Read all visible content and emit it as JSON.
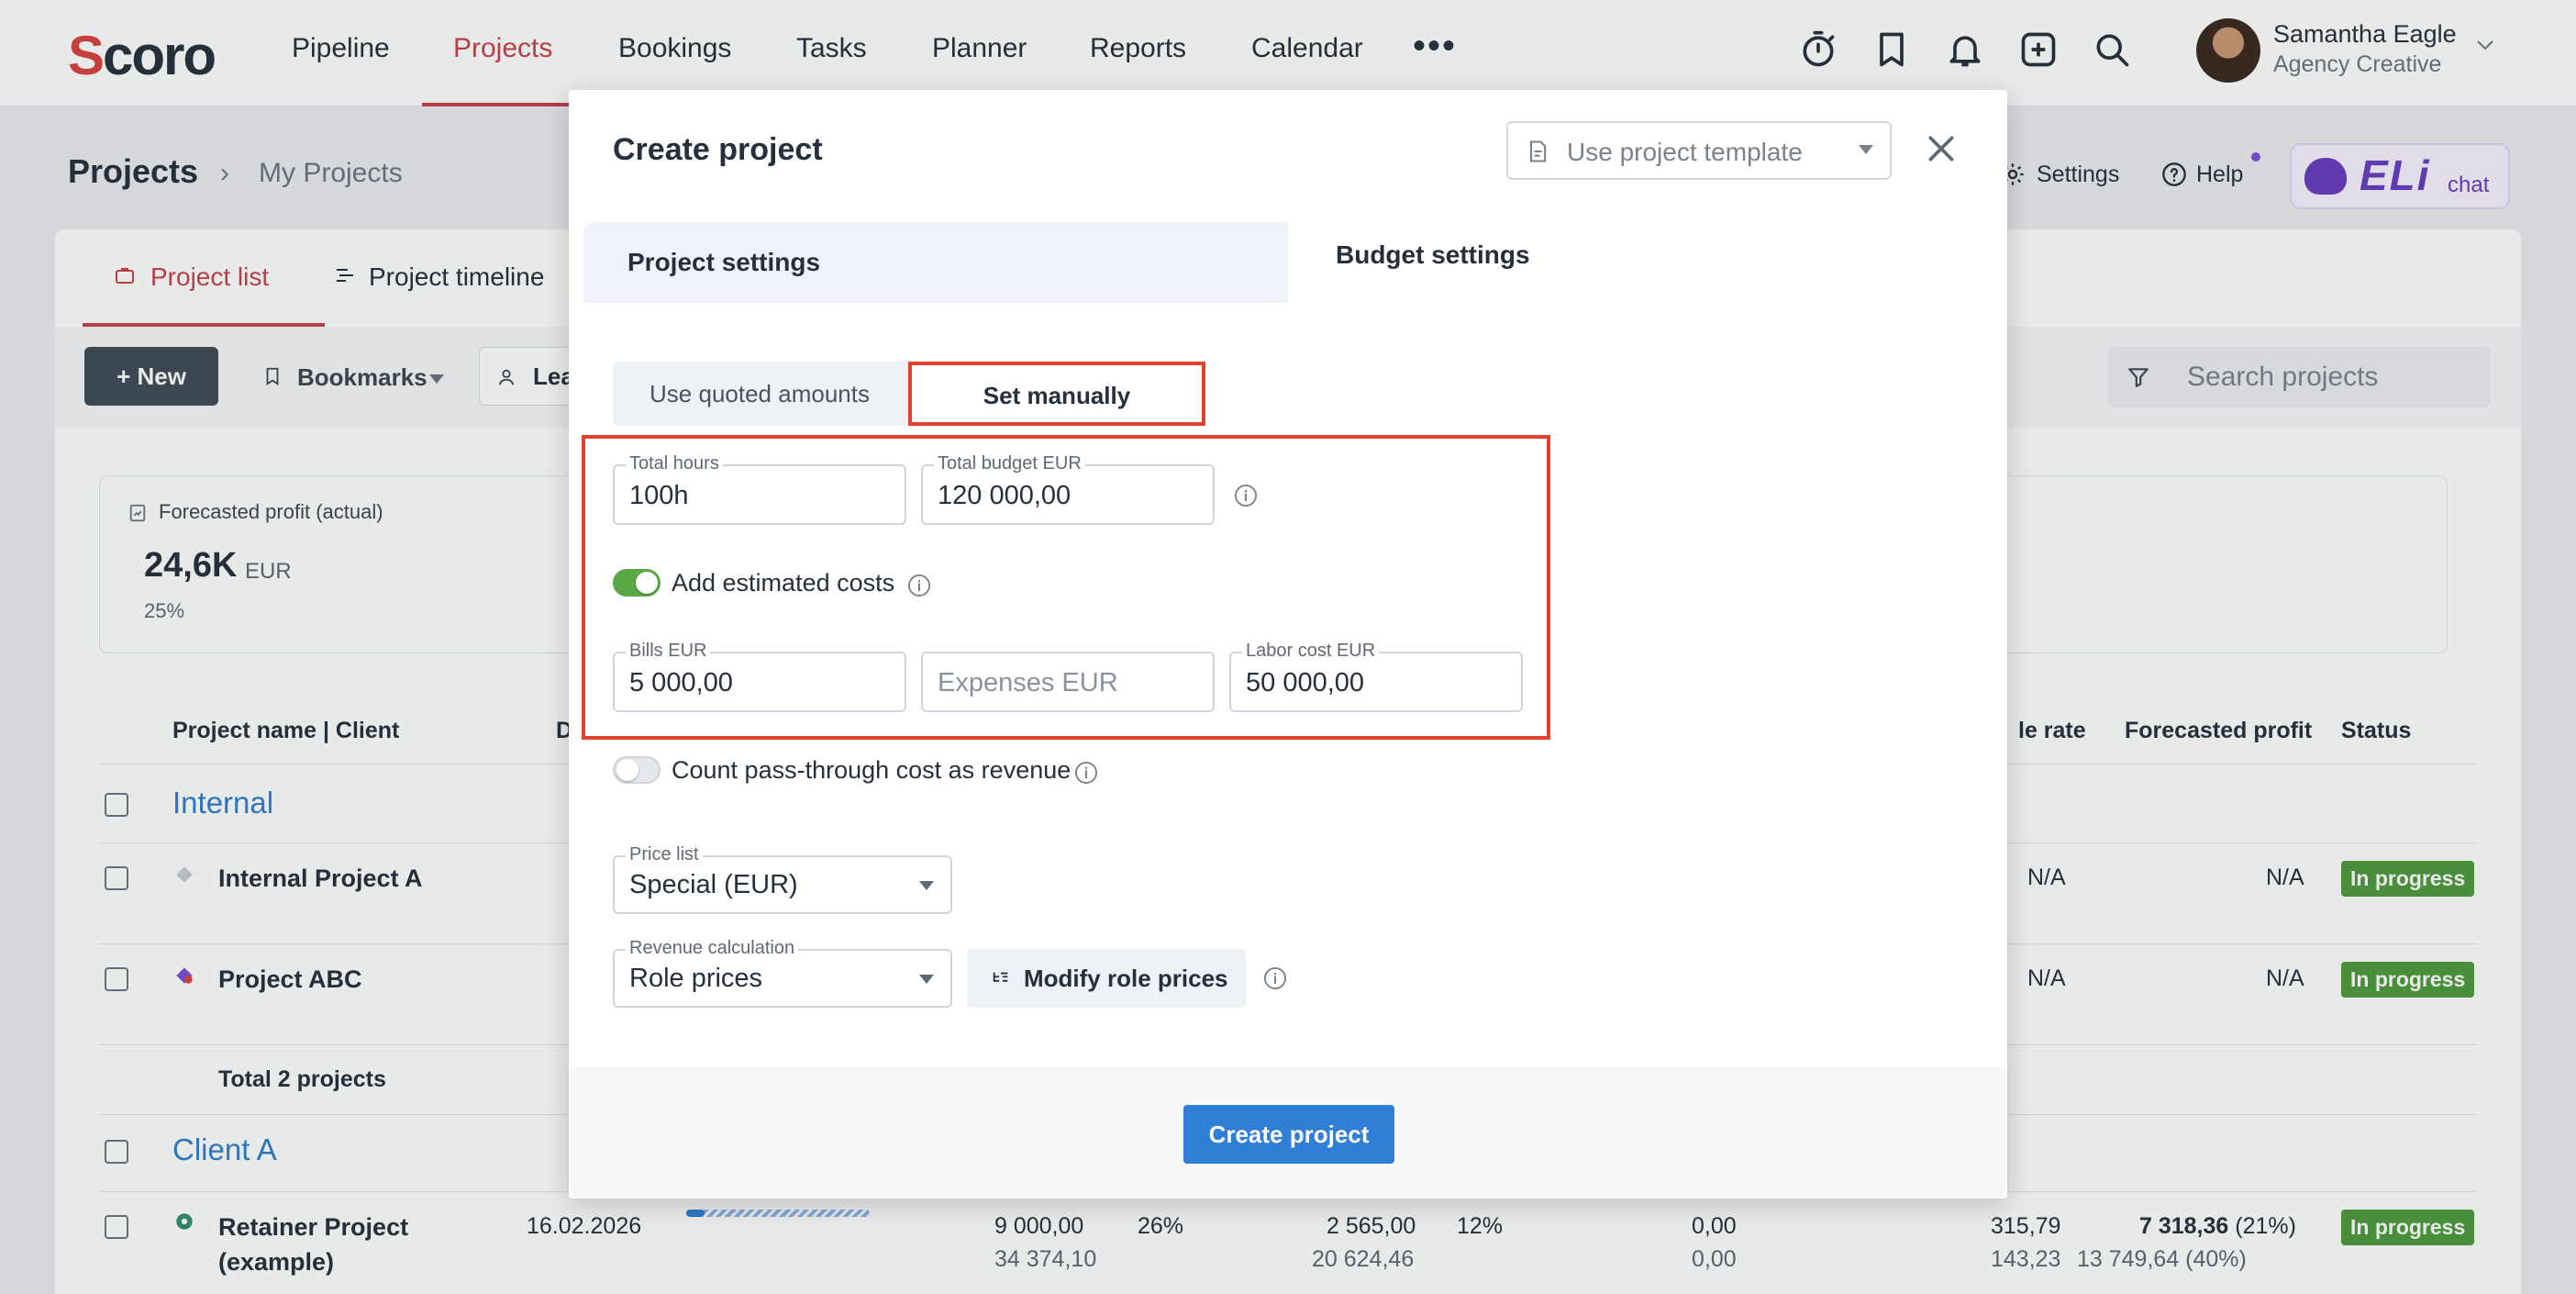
{
  "nav": {
    "logo_s": "S",
    "logo_rest": "coro",
    "items": [
      "Pipeline",
      "Projects",
      "Bookings",
      "Tasks",
      "Planner",
      "Reports",
      "Calendar"
    ],
    "more": "•••"
  },
  "user": {
    "name": "Samantha Eagle",
    "role": "Agency Creative"
  },
  "header": {
    "title": "Projects",
    "breadcrumb": "My Projects",
    "settings": "Settings",
    "help": "Help",
    "eli": "ELi",
    "eli_chat": "chat"
  },
  "tabs": {
    "project_list": "Project list",
    "project_timeline": "Project timeline"
  },
  "toolbar": {
    "new": "+ New",
    "bookmarks": "Bookmarks",
    "lead": "Lea",
    "search_placeholder": "Search projects"
  },
  "summary": {
    "label": "Forecasted profit (actual)",
    "value": "24,6K",
    "unit": "EUR",
    "pct": "25%"
  },
  "table": {
    "headers": {
      "name": "Project name | Client",
      "d": "D",
      "rate": "le rate",
      "profit": "Forecasted profit",
      "status": "Status"
    },
    "groups": [
      {
        "title": "Internal"
      },
      {
        "title": "Client A"
      }
    ],
    "rows": [
      {
        "name": "Internal Project A",
        "rate": "N/A",
        "profit": "N/A",
        "status": "In progress"
      },
      {
        "name": "Project ABC",
        "rate": "N/A",
        "profit": "N/A",
        "status": "In progress"
      },
      {
        "name_l1": "Retainer Project",
        "name_l2": "(example)",
        "date": "16.02.2026",
        "c1a": "9 000,00",
        "c1b": "34 374,10",
        "pct1": "26%",
        "c2a": "2 565,00",
        "c2b": "20 624,46",
        "pct2": "12%",
        "c3a": "0,00",
        "c3b": "0,00",
        "rate_a": "315,79",
        "rate_b": "143,23",
        "profit_a": "7 318,36",
        "profit_a_pct": "(21%)",
        "profit_b": "13 749,64 (40%)",
        "status": "In progress"
      }
    ],
    "total": "Total 2 projects"
  },
  "modal": {
    "title": "Create project",
    "template_placeholder": "Use project template",
    "section_project": "Project settings",
    "section_budget": "Budget settings",
    "seg_quoted": "Use quoted amounts",
    "seg_manual": "Set manually",
    "total_hours": {
      "label": "Total hours",
      "value": "100h"
    },
    "total_budget": {
      "label": "Total budget EUR",
      "value": "120 000,00"
    },
    "add_costs": {
      "label": "Add estimated costs",
      "on": true
    },
    "bills": {
      "label": "Bills EUR",
      "value": "5 000,00"
    },
    "expenses": {
      "placeholder": "Expenses EUR"
    },
    "labor": {
      "label": "Labor cost EUR",
      "value": "50 000,00"
    },
    "pass_through": {
      "label": "Count pass-through cost as revenue",
      "on": false
    },
    "price_list": {
      "label": "Price list",
      "value": "Special (EUR)"
    },
    "revenue_calc": {
      "label": "Revenue calculation",
      "value": "Role prices"
    },
    "modify_btn": "Modify role prices",
    "create_btn": "Create project"
  },
  "colors": {
    "accent": "#c8414a",
    "primary": "#2f7fd6",
    "highlight": "#e2412e",
    "status_green": "#4d9a3e",
    "toggle_on": "#5aa845"
  }
}
